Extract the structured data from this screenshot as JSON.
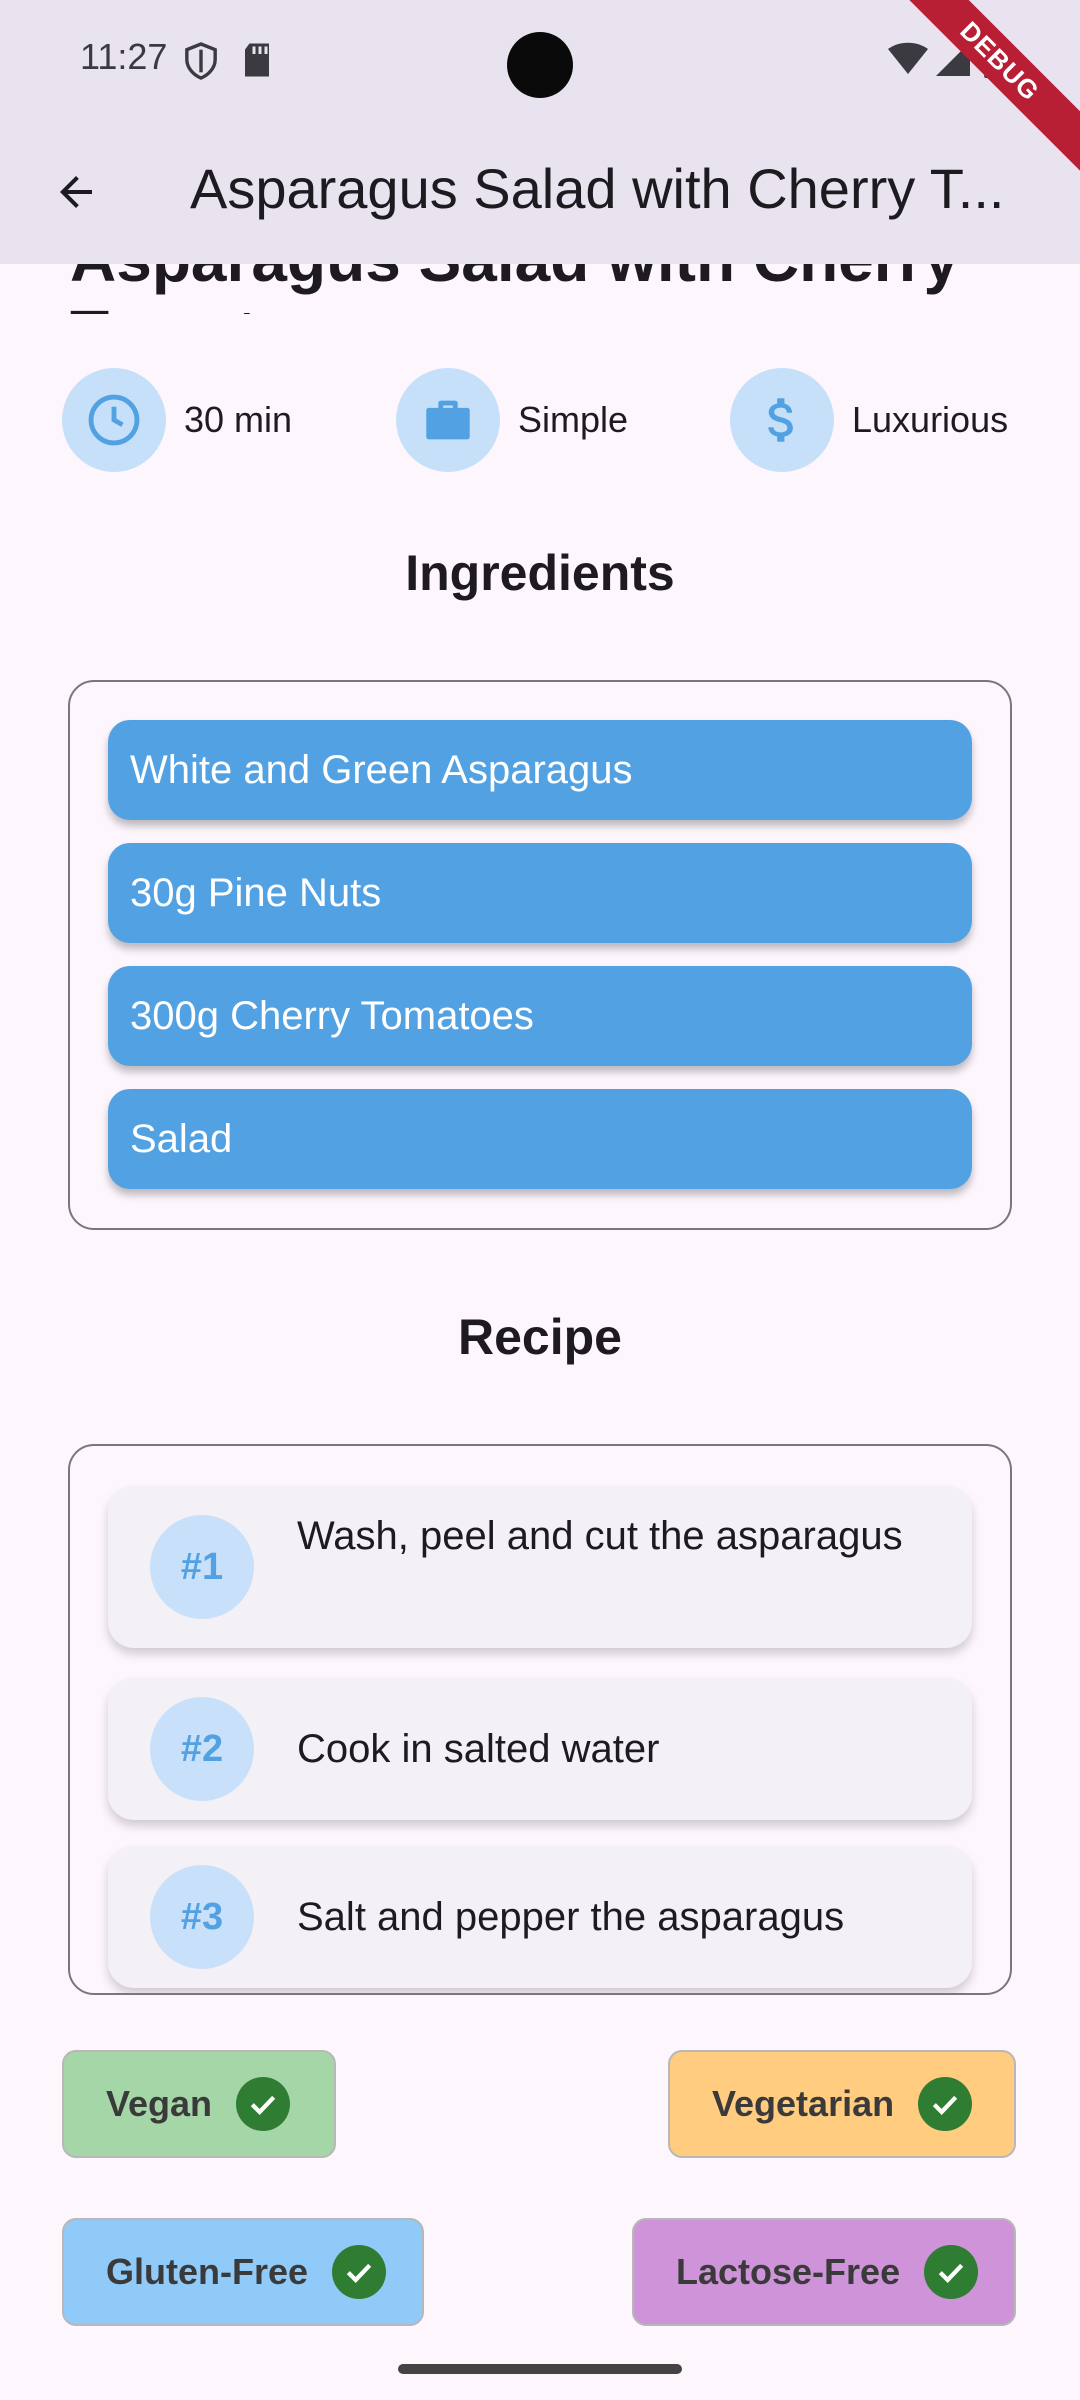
{
  "status_bar": {
    "time": "11:27"
  },
  "debug_banner": "DEBUG",
  "app_bar": {
    "title": "Asparagus Salad with Cherry T..."
  },
  "peek_title": "Asparagus Salad with Cherry Tomatoes",
  "info": [
    {
      "icon": "clock-icon",
      "label": "30 min"
    },
    {
      "icon": "briefcase-icon",
      "label": "Simple"
    },
    {
      "icon": "dollar-icon",
      "label": "Luxurious"
    }
  ],
  "ingredients_title": "Ingredients",
  "ingredients": [
    "White and Green Asparagus",
    "30g Pine Nuts",
    "300g Cherry Tomatoes",
    "Salad"
  ],
  "recipe_title": "Recipe",
  "steps": [
    {
      "num": "#1",
      "text": "Wash, peel and cut the asparagus"
    },
    {
      "num": "#2",
      "text": "Cook in salted water"
    },
    {
      "num": "#3",
      "text": "Salt and pepper the asparagus"
    }
  ],
  "tags": [
    {
      "label": "Vegan",
      "color": "#a5d6a7"
    },
    {
      "label": "Vegetarian",
      "color": "#ffcc80"
    },
    {
      "label": "Gluten-Free",
      "color": "#90caf9"
    },
    {
      "label": "Lactose-Free",
      "color": "#ce93d8"
    }
  ],
  "colors": {
    "accent": "#52a2e3",
    "app_bar": "#e8e3ef",
    "background": "#fdf7fd",
    "check": "#2e7d32"
  }
}
